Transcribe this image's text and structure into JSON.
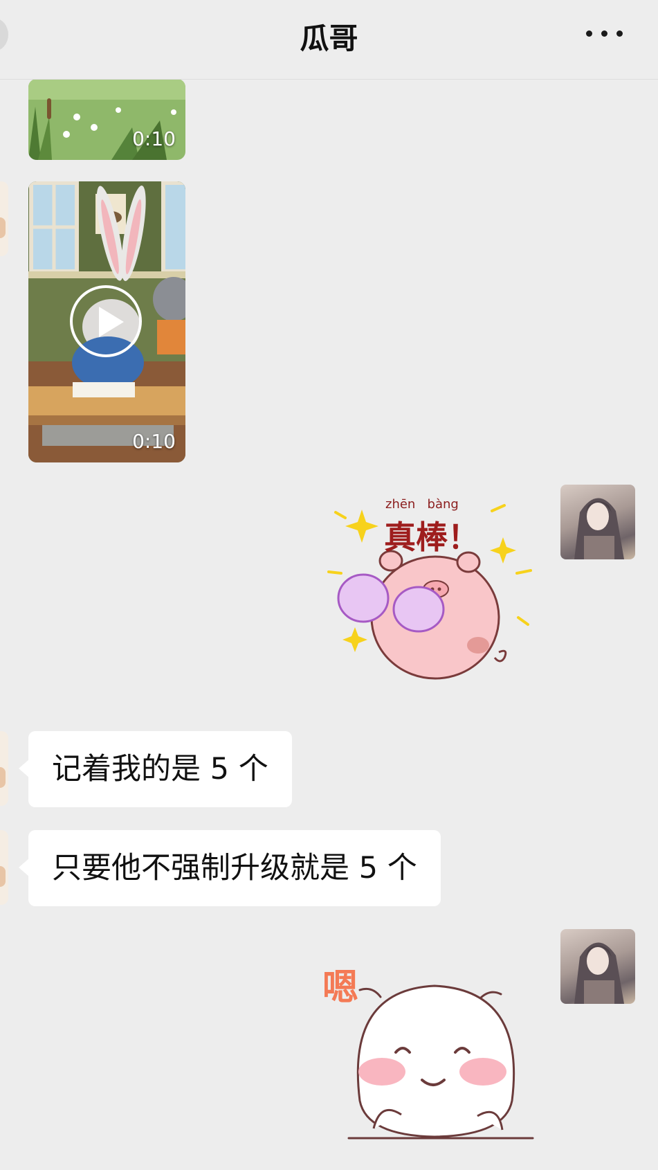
{
  "header": {
    "title": "瓜哥",
    "more_icon": "more-dots-icon"
  },
  "messages": [
    {
      "kind": "video",
      "side": "left",
      "duration": "0:10"
    },
    {
      "kind": "video",
      "side": "left",
      "duration": "0:10"
    },
    {
      "kind": "sticker",
      "side": "right",
      "pinyin_1": "zhēn",
      "pinyin_2": "bàng",
      "caption": "真棒！"
    },
    {
      "kind": "text",
      "side": "left",
      "text": "记着我的是 5 个"
    },
    {
      "kind": "text",
      "side": "left",
      "text": "只要他不强制升级就是 5 个"
    },
    {
      "kind": "sticker",
      "side": "right",
      "caption": "嗯"
    }
  ],
  "colors": {
    "background": "#ededed",
    "bubble": "#ffffff",
    "text": "#111111"
  }
}
